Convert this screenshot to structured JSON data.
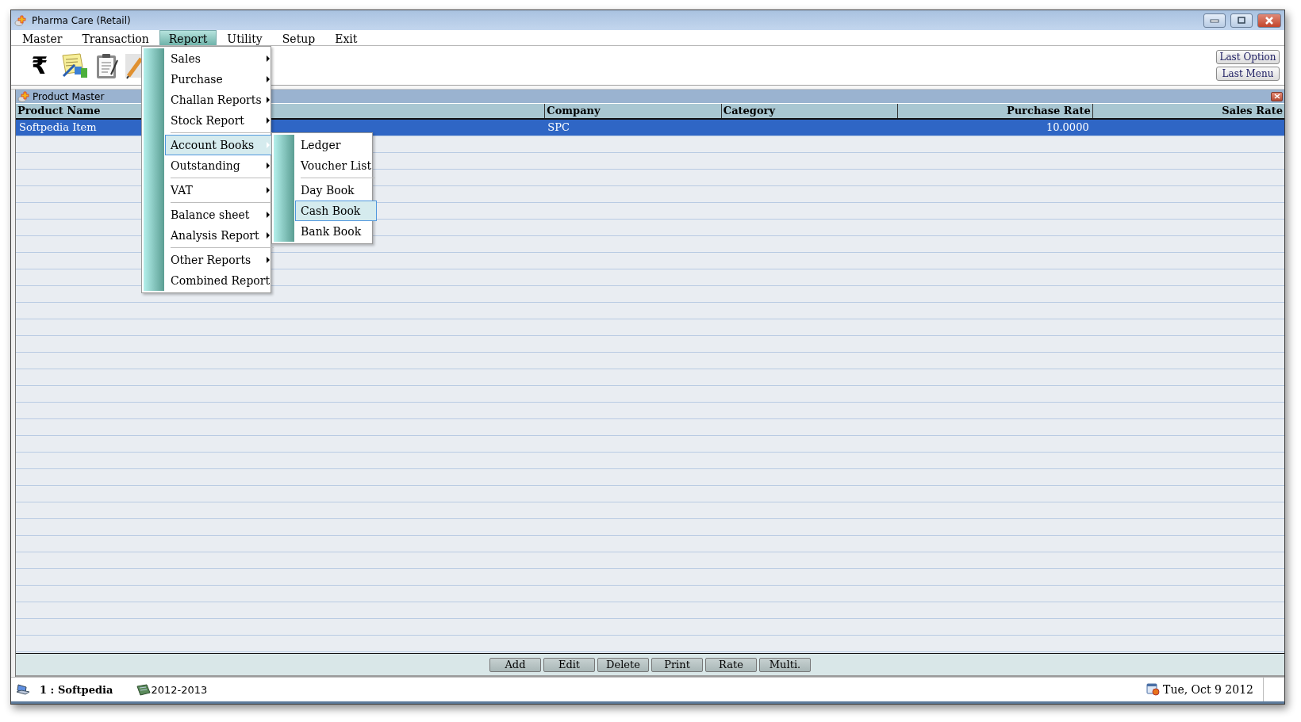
{
  "window": {
    "title": "Pharma Care (Retail)"
  },
  "menu_bar": [
    {
      "label": "Master",
      "selected": false
    },
    {
      "label": "Transaction",
      "selected": false
    },
    {
      "label": "Report",
      "selected": true
    },
    {
      "label": "Utility",
      "selected": false
    },
    {
      "label": "Setup",
      "selected": false
    },
    {
      "label": "Exit",
      "selected": false
    }
  ],
  "toolbar": {
    "rupee": "₹"
  },
  "side_buttons": [
    "Last Option",
    "Last Menu"
  ],
  "report_menu": [
    {
      "label": "Sales",
      "submenu": true,
      "selected": false,
      "separator_above": false
    },
    {
      "label": "Purchase",
      "submenu": true,
      "selected": false,
      "separator_above": false
    },
    {
      "label": "Challan Reports",
      "submenu": true,
      "selected": false,
      "separator_above": false
    },
    {
      "label": "Stock Report",
      "submenu": true,
      "selected": false,
      "separator_above": false
    },
    {
      "label": "Account Books",
      "submenu": true,
      "selected": true,
      "separator_above": true
    },
    {
      "label": "Outstanding",
      "submenu": true,
      "selected": false,
      "separator_above": false
    },
    {
      "label": "VAT",
      "submenu": true,
      "selected": false,
      "separator_above": true
    },
    {
      "label": "Balance sheet",
      "submenu": true,
      "selected": false,
      "separator_above": true
    },
    {
      "label": "Analysis Report",
      "submenu": true,
      "selected": false,
      "separator_above": false
    },
    {
      "label": "Other Reports",
      "submenu": true,
      "selected": false,
      "separator_above": true
    },
    {
      "label": "Combined Report",
      "submenu": false,
      "selected": false,
      "separator_above": false
    }
  ],
  "account_books_menu": [
    {
      "label": "Ledger",
      "submenu": false,
      "selected": false,
      "separator_above": false
    },
    {
      "label": "Voucher List",
      "submenu": false,
      "selected": false,
      "separator_above": false
    },
    {
      "label": "Day Book",
      "submenu": false,
      "selected": false,
      "separator_above": true
    },
    {
      "label": "Cash Book",
      "submenu": false,
      "selected": true,
      "separator_above": false
    },
    {
      "label": "Bank Book",
      "submenu": false,
      "selected": false,
      "separator_above": false
    }
  ],
  "child_window": {
    "title": "Product Master"
  },
  "table": {
    "columns": [
      {
        "label": "Product Name",
        "numeric": false
      },
      {
        "label": "Company",
        "numeric": false
      },
      {
        "label": "Category",
        "numeric": false
      },
      {
        "label": "Purchase Rate",
        "numeric": true
      },
      {
        "label": "Sales Rate",
        "numeric": true
      }
    ],
    "rows": [
      {
        "cells": [
          "Softpedia Item",
          "SPC",
          null,
          "10.0000",
          null
        ],
        "selected": true
      }
    ]
  },
  "bottom_buttons": [
    "Add",
    "Edit",
    "Delete",
    "Print",
    "Rate",
    "Multi."
  ],
  "status_bar": {
    "company": "1 : Softpedia",
    "year": "2012-2013",
    "date": "Tue, Oct 9 2012"
  }
}
